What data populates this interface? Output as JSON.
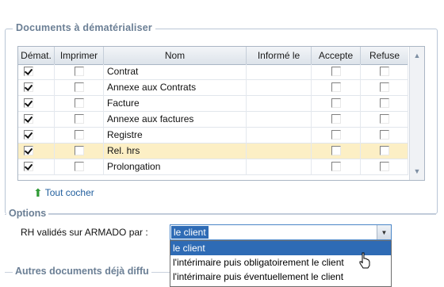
{
  "documents_group": {
    "title": "Documents à dématérialiser",
    "columns": [
      "Démat.",
      "Imprimer",
      "Nom",
      "Informé le",
      "Accepte",
      "Refuse"
    ],
    "rows": [
      {
        "demat": true,
        "imprimer": false,
        "nom": "Contrat",
        "informe": "",
        "accepte": false,
        "refuse": false
      },
      {
        "demat": true,
        "imprimer": false,
        "nom": "Annexe aux Contrats",
        "informe": "",
        "accepte": false,
        "refuse": false
      },
      {
        "demat": true,
        "imprimer": false,
        "nom": "Facture",
        "informe": "",
        "accepte": false,
        "refuse": false
      },
      {
        "demat": true,
        "imprimer": false,
        "nom": "Annexe aux factures",
        "informe": "",
        "accepte": false,
        "refuse": false
      },
      {
        "demat": true,
        "imprimer": false,
        "nom": "Registre",
        "informe": "",
        "accepte": false,
        "refuse": false
      },
      {
        "demat": true,
        "imprimer": false,
        "nom": "Rel. hrs",
        "informe": "",
        "accepte": false,
        "refuse": false,
        "selected": true
      },
      {
        "demat": true,
        "imprimer": false,
        "nom": "Prolongation",
        "informe": "",
        "accepte": false,
        "refuse": false
      }
    ],
    "tout_cocher": "Tout cocher"
  },
  "options": {
    "title": "Options",
    "rh_label": "RH validés sur ARMADO par :",
    "combo_value": "le client",
    "dropdown_options": [
      "le client",
      "l'intérimaire puis obligatoirement le client",
      "l'intérimaire puis éventuellement le client"
    ],
    "highlighted_index": 0
  },
  "autres_group": {
    "title": "Autres documents déjà diffu"
  },
  "colors": {
    "group_title": "#6b7f95",
    "selection_row": "#fcefc5",
    "highlight": "#2e6bb5",
    "link": "#1f5d9c"
  }
}
